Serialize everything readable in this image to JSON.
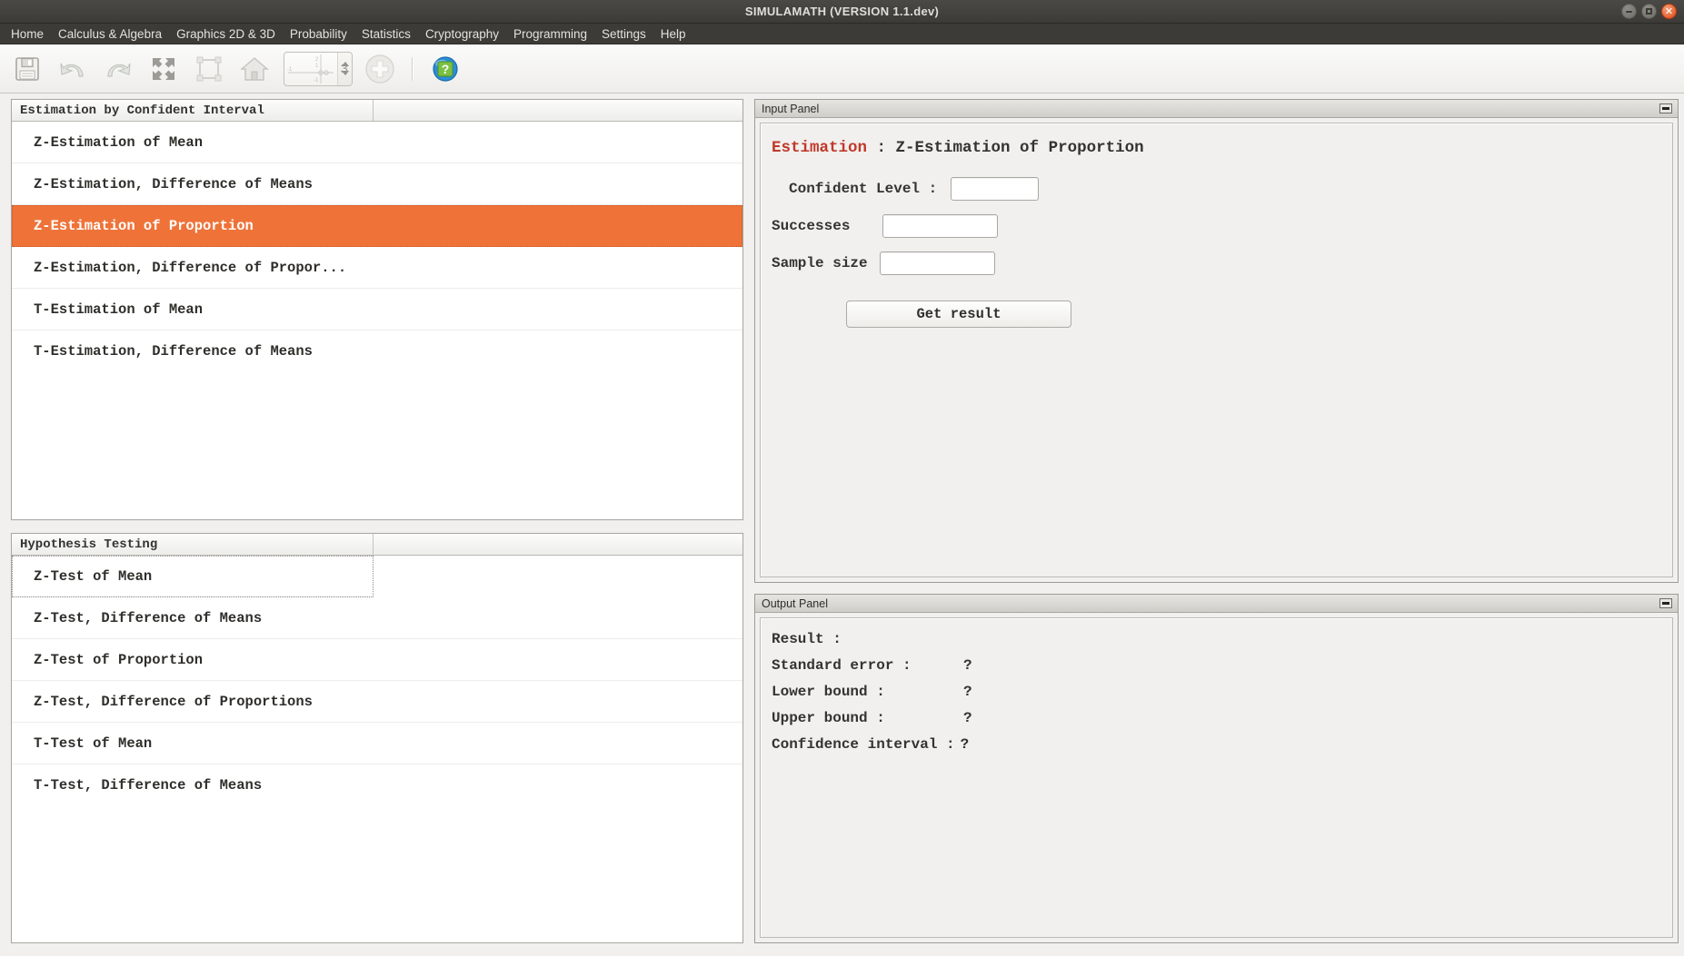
{
  "window": {
    "title": "SIMULAMATH  (VERSION 1.1.dev)",
    "controls": [
      {
        "name": "minimize-button",
        "glyph": "minimize"
      },
      {
        "name": "maximize-button",
        "glyph": "maximize"
      },
      {
        "name": "close-button",
        "glyph": "close"
      }
    ]
  },
  "menubar": {
    "items": [
      {
        "label": "Home"
      },
      {
        "label": "Calculus & Algebra"
      },
      {
        "label": "Graphics 2D & 3D"
      },
      {
        "label": "Probability"
      },
      {
        "label": "Statistics"
      },
      {
        "label": "Cryptography"
      },
      {
        "label": "Programming"
      },
      {
        "label": "Settings"
      },
      {
        "label": "Help"
      }
    ]
  },
  "toolbar": {
    "buttons": [
      {
        "icon": "save-icon",
        "tip": "Save"
      },
      {
        "icon": "undo-icon",
        "tip": "Undo"
      },
      {
        "icon": "redo-icon",
        "tip": "Redo"
      },
      {
        "icon": "expand-arrows-icon",
        "tip": "Expand"
      },
      {
        "icon": "select-frame-icon",
        "tip": "Select frame"
      },
      {
        "icon": "home-icon",
        "tip": "Home view"
      }
    ],
    "spinner": {
      "value": "3",
      "axis_labels": [
        "2",
        "1",
        "-1",
        "-1"
      ]
    },
    "zoom_in": {
      "icon": "plus-circle-icon"
    },
    "help": {
      "icon": "help-globe-icon",
      "glyph": "?"
    }
  },
  "estimation_table": {
    "header": "Estimation by Confident Interval",
    "rows": [
      {
        "label": "Z-Estimation of Mean",
        "selected": false
      },
      {
        "label": "Z-Estimation, Difference of Means",
        "selected": false
      },
      {
        "label": "Z-Estimation of Proportion",
        "selected": true
      },
      {
        "label": "Z-Estimation, Difference of Propor...",
        "selected": false
      },
      {
        "label": "T-Estimation of Mean",
        "selected": false
      },
      {
        "label": "T-Estimation, Difference of Means",
        "selected": false
      }
    ]
  },
  "hypothesis_table": {
    "header": "Hypothesis Testing",
    "rows": [
      {
        "label": "Z-Test of Mean",
        "focused": true
      },
      {
        "label": "Z-Test, Difference of Means",
        "focused": false
      },
      {
        "label": "Z-Test of Proportion",
        "focused": false
      },
      {
        "label": "Z-Test, Difference of Proportions",
        "focused": false
      },
      {
        "label": "T-Test of Mean",
        "focused": false
      },
      {
        "label": "T-Test, Difference of Means",
        "focused": false
      }
    ]
  },
  "input_panel": {
    "panel_title": "Input Panel",
    "heading_accent": "Estimation",
    "heading_rest": " : Z-Estimation of Proportion",
    "fields": [
      {
        "label": "Confident Level :",
        "value": "",
        "placeholder": ""
      },
      {
        "label": "Successes",
        "value": "",
        "placeholder": ""
      },
      {
        "label": "Sample size",
        "value": "",
        "placeholder": ""
      }
    ],
    "submit_label": "Get result"
  },
  "output_panel": {
    "panel_title": "Output Panel",
    "lines": [
      {
        "key": "Result :",
        "value": ""
      },
      {
        "key": "Standard error :",
        "value": "?"
      },
      {
        "key": "Lower bound :",
        "value": "?"
      },
      {
        "key": "Upper bound :",
        "value": "?"
      },
      {
        "key": "Confidence interval :",
        "value": "?"
      }
    ]
  },
  "colors": {
    "selection": "#ef7339",
    "accent_red": "#c0392b",
    "titlebar": "#3c3b37",
    "close_button": "#dd4814"
  }
}
